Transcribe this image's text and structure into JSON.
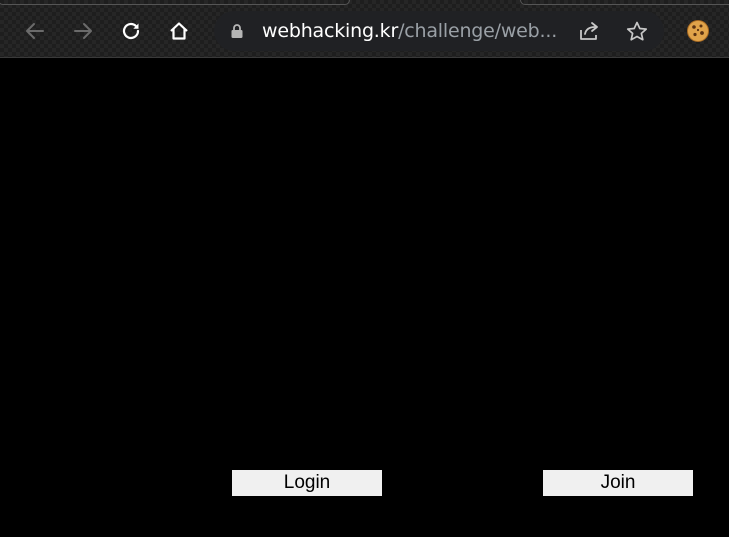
{
  "browser": {
    "url_host": "webhacking.kr",
    "url_path": "/challenge/web..."
  },
  "icons": {
    "back": "arrow-left-icon",
    "forward": "arrow-right-icon",
    "reload": "reload-icon",
    "home": "home-icon",
    "lock": "lock-icon",
    "share": "share-icon",
    "bookmark": "star-icon",
    "extension": "cookie-icon"
  },
  "colors": {
    "page_background": "#000000",
    "button_background": "#f0f0f0",
    "url_host": "#ffffff",
    "url_path": "#9aa0a6"
  },
  "page": {
    "login_label": "Login",
    "join_label": "Join"
  }
}
